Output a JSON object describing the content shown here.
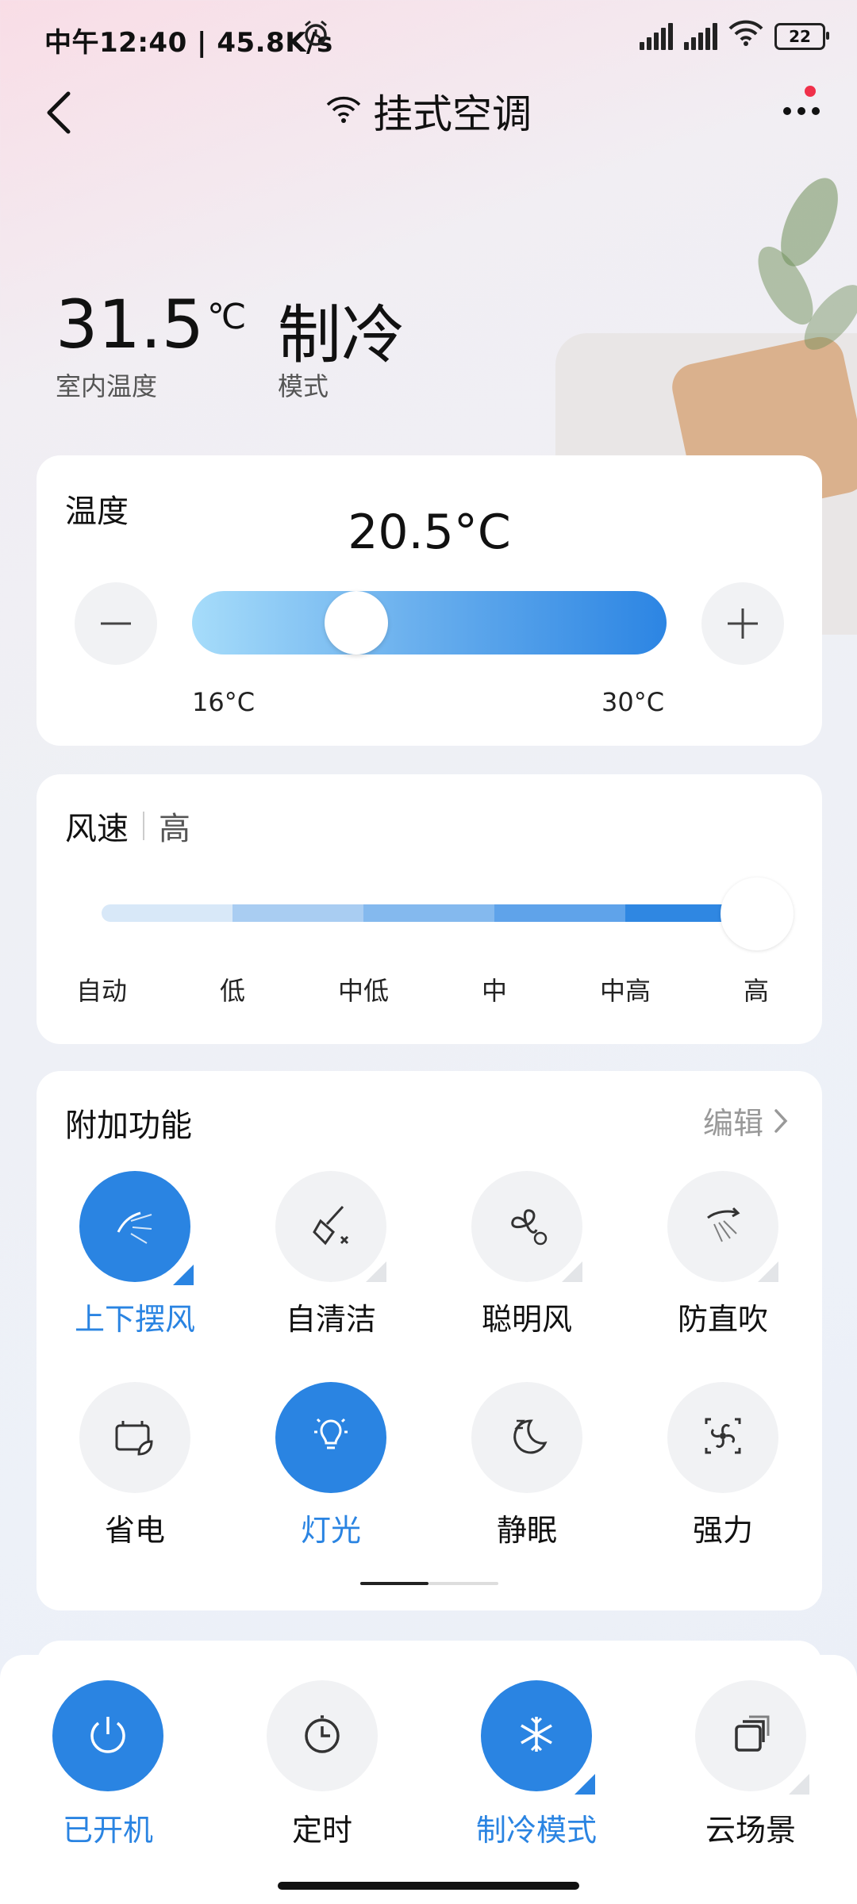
{
  "status_bar": {
    "time": "中午12:40 | 45.8K/s",
    "battery": "22"
  },
  "header": {
    "title": "挂式空调"
  },
  "hero": {
    "indoor_temp": "31.5",
    "temp_unit": "℃",
    "indoor_temp_label": "室内温度",
    "mode": "制冷",
    "mode_label": "模式"
  },
  "temperature_card": {
    "title": "温度",
    "value": "20.5°C",
    "min_label": "16°C",
    "max_label": "30°C",
    "setpoint": 20.5,
    "range": [
      16,
      30
    ]
  },
  "wind_card": {
    "title": "风速",
    "current": "高",
    "levels": [
      "自动",
      "低",
      "中低",
      "中",
      "中高",
      "高"
    ],
    "selected_index": 5
  },
  "features_card": {
    "title": "附加功能",
    "edit_label": "编辑",
    "items": [
      {
        "label": "上下摆风",
        "active": true,
        "icon": "swing-vertical-icon"
      },
      {
        "label": "自清洁",
        "active": false,
        "icon": "self-clean-icon"
      },
      {
        "label": "聪明风",
        "active": false,
        "icon": "smart-wind-icon"
      },
      {
        "label": "防直吹",
        "active": false,
        "icon": "anti-direct-blow-icon"
      },
      {
        "label": "省电",
        "active": false,
        "icon": "power-save-icon"
      },
      {
        "label": "灯光",
        "active": true,
        "icon": "light-bulb-icon"
      },
      {
        "label": "静眠",
        "active": false,
        "icon": "sleep-moon-icon"
      },
      {
        "label": "强力",
        "active": false,
        "icon": "turbo-fan-icon"
      }
    ]
  },
  "bottom_bar": {
    "items": [
      {
        "label": "已开机",
        "active": true,
        "icon": "power-icon"
      },
      {
        "label": "定时",
        "active": false,
        "icon": "timer-icon"
      },
      {
        "label": "制冷模式",
        "active": true,
        "icon": "snowflake-icon"
      },
      {
        "label": "云场景",
        "active": false,
        "icon": "scenes-icon"
      }
    ]
  },
  "colors": {
    "accent": "#2a84e2",
    "chip_bg": "#f1f2f4"
  }
}
